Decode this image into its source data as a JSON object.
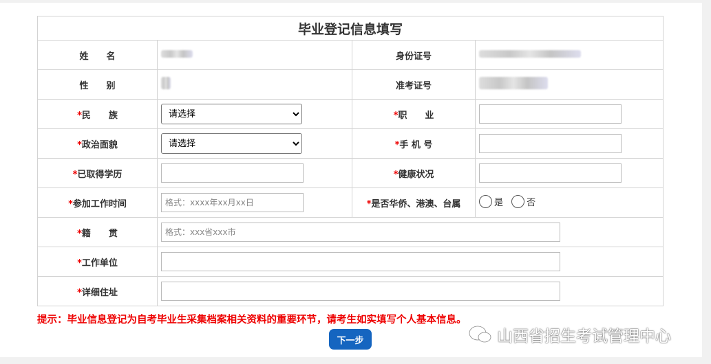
{
  "title": "毕业登记信息填写",
  "fields": {
    "name": "姓　　名",
    "id_no": "身份证号",
    "gender": "性　　别",
    "exam_no": "准考证号",
    "ethnicity": "民　　族",
    "occupation": "职　　业",
    "politics": "政治面貌",
    "phone": "手 机 号",
    "education": "已取得学历",
    "health": "健康状况",
    "work_time": "参加工作时间",
    "overseas": "是否华侨、港澳、台属",
    "native": "籍　　贯",
    "employer": "工作单位",
    "address": "详细住址"
  },
  "required_mark": "*",
  "select_default": "请选择",
  "placeholders": {
    "work_time": "格式：xxxx年xx月xx日",
    "native": "格式：xxx省xxx市"
  },
  "radio": {
    "yes": "是",
    "no": "否"
  },
  "hint": "提示：毕业信息登记为自考毕业生采集档案相关资料的重要环节，请考生如实填写个人基本信息。",
  "next_label": "下一步",
  "watermark": "山西省招生考试管理中心"
}
